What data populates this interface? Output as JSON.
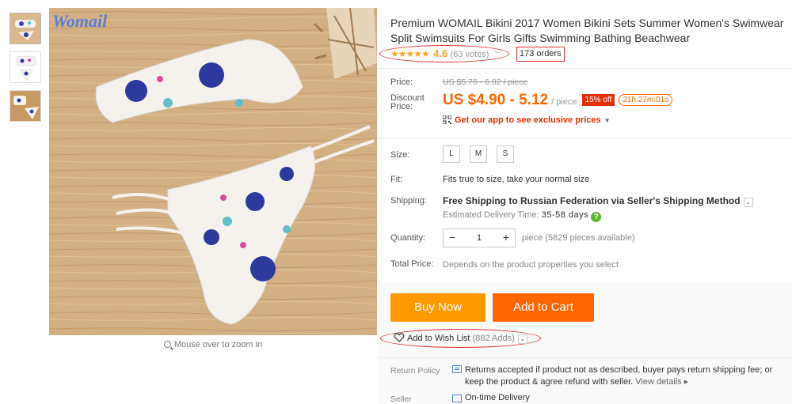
{
  "product": {
    "title": "Premium WOMAIL Bikini 2017 Women Bikini Sets Summer Women's Swimwear Split Swimsuits For Girls Gifts Swimming Bathing Beachwear",
    "brand_watermark": "Womail",
    "zoom_hint": "Mouse over to zoom in"
  },
  "rating": {
    "stars": "★★★★★",
    "score": "4.6",
    "votes": "(63 votes)",
    "orders": "173 orders"
  },
  "price": {
    "price_label": "Price:",
    "old_price": "US $5.76 - 6.02 / piece",
    "discount_label_1": "Discount",
    "discount_label_2": "Price:",
    "current_price": "US $4.90 - 5.12",
    "per_unit": "/ piece",
    "discount_badge": "15% off",
    "timer": "21h:27m:01s",
    "app_promo": "Get our app to see exclusive prices"
  },
  "options": {
    "size_label": "Size:",
    "sizes": [
      "L",
      "M",
      "S"
    ],
    "fit_label": "Fit:",
    "fit_value": "Fits true to size, take your normal size",
    "shipping_label": "Shipping:",
    "shipping_value": "Free Shipping to Russian Federation via Seller's Shipping Method",
    "est_label": "Estimated Delivery Time:",
    "est_value": "35-58 days",
    "quantity_label": "Quantity:",
    "quantity_value": "1",
    "quantity_minus": "−",
    "quantity_plus": "+",
    "quantity_note": "piece (5829 pieces available)",
    "total_label": "Total Price:",
    "total_value": "Depends on the product properties you select"
  },
  "actions": {
    "buy_now": "Buy Now",
    "add_to_cart": "Add to Cart",
    "wishlist": "Add to Wish List",
    "wishlist_count": "(882 Adds)"
  },
  "policy": {
    "return_label": "Return Policy",
    "return_text": "Returns accepted if product not as described, buyer pays return shipping fee; or keep the product & agree refund with seller.",
    "view_details": "View details",
    "seller_label": "Seller",
    "seller_text": "On-time Delivery"
  },
  "colors": {
    "accent_orange": "#ff6600",
    "buy_button": "#ff9900",
    "discount_red": "#e62e04",
    "star": "#f5a623",
    "annotation_red": "#dd3333"
  }
}
